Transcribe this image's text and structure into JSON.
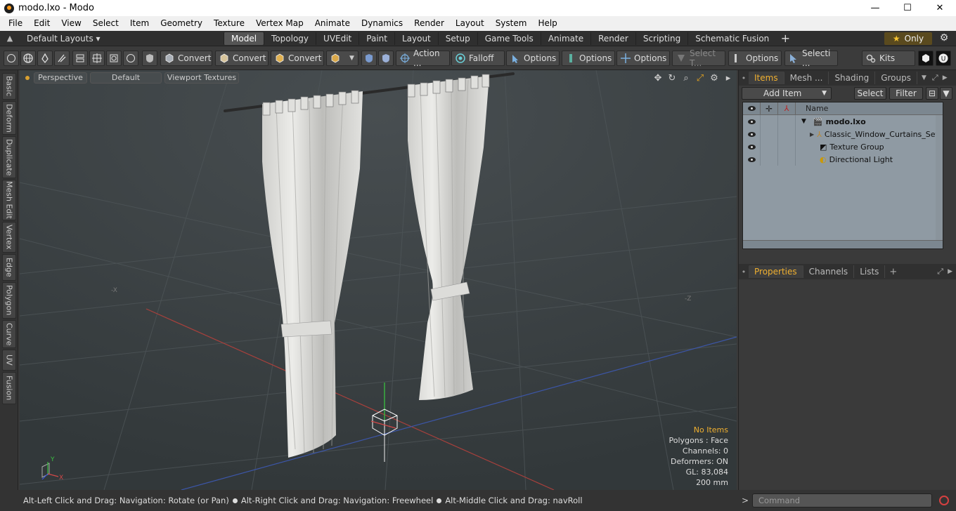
{
  "window": {
    "title": "modo.lxo - Modo",
    "minimize": "—",
    "maximize": "☐",
    "close": "✕"
  },
  "menu": [
    "File",
    "Edit",
    "View",
    "Select",
    "Item",
    "Geometry",
    "Texture",
    "Vertex Map",
    "Animate",
    "Dynamics",
    "Render",
    "Layout",
    "System",
    "Help"
  ],
  "layouts": {
    "dropdown": "Default Layouts ▾",
    "tabs": [
      "Model",
      "Topology",
      "UVEdit",
      "Paint",
      "Layout",
      "Setup",
      "Game Tools",
      "Animate",
      "Render",
      "Scripting",
      "Schematic Fusion"
    ],
    "active": "Model",
    "plus": "+",
    "only_label": "Only",
    "star": "★",
    "gear": "⚙"
  },
  "toolbar": {
    "convert1": "Convert",
    "convert2": "Convert",
    "convert3": "Convert",
    "action": "Action ...",
    "falloff": "Falloff",
    "options1": "Options",
    "options2": "Options",
    "options3": "Options",
    "select_t": "Select T...",
    "options4": "Options",
    "selecti": "Selecti ...",
    "kits": "Kits"
  },
  "left_tabs": [
    "Basic",
    "Deform",
    "Duplicate",
    "Mesh Edit",
    "Vertex",
    "Edge",
    "Polygon",
    "Curve",
    "UV",
    "Fusion"
  ],
  "viewport": {
    "view": "Perspective",
    "shading": "Default",
    "textures": "Viewport Textures",
    "info": {
      "no_items": "No Items",
      "polygons": "Polygons : Face",
      "channels": "Channels: 0",
      "deformers": "Deformers: ON",
      "gl": "GL: 83,084",
      "scale": "200 mm"
    },
    "axis_y": "Y",
    "axis_x": "X",
    "marker_x": "-X",
    "marker_z": "-Z"
  },
  "items_panel": {
    "tabs": [
      "Items",
      "Mesh ...",
      "Shading",
      "Groups"
    ],
    "active": "Items",
    "add_item": "Add Item",
    "select": "Select",
    "filter": "Filter",
    "column_name": "Name",
    "rows": [
      {
        "label": "modo.lxo",
        "bold": true,
        "indent": 0,
        "icon": "scene-icon"
      },
      {
        "label": "Classic_Window_Curtains_Set",
        "bold": false,
        "indent": 1,
        "icon": "mesh-locator-icon"
      },
      {
        "label": "Texture Group",
        "bold": false,
        "indent": 1,
        "icon": "texture-group-icon"
      },
      {
        "label": "Directional Light",
        "bold": false,
        "indent": 1,
        "icon": "light-icon"
      }
    ]
  },
  "properties_panel": {
    "tabs": [
      "Properties",
      "Channels",
      "Lists"
    ],
    "active": "Properties",
    "plus": "+"
  },
  "status": {
    "part1": "Alt-Left Click and Drag: Navigation: Rotate (or Pan)",
    "part2": "Alt-Right Click and Drag: Navigation: Freewheel",
    "part3": "Alt-Middle Click and Drag: navRoll"
  },
  "command": {
    "prompt": ">",
    "placeholder": "Command"
  },
  "colors": {
    "accent": "#f0b030",
    "viewport_bg": "#3e4446",
    "item_list_bg": "#8f9aa3",
    "x_axis": "#c03a3a",
    "z_axis": "#3a5ac0",
    "y_axis": "#3ac040"
  }
}
